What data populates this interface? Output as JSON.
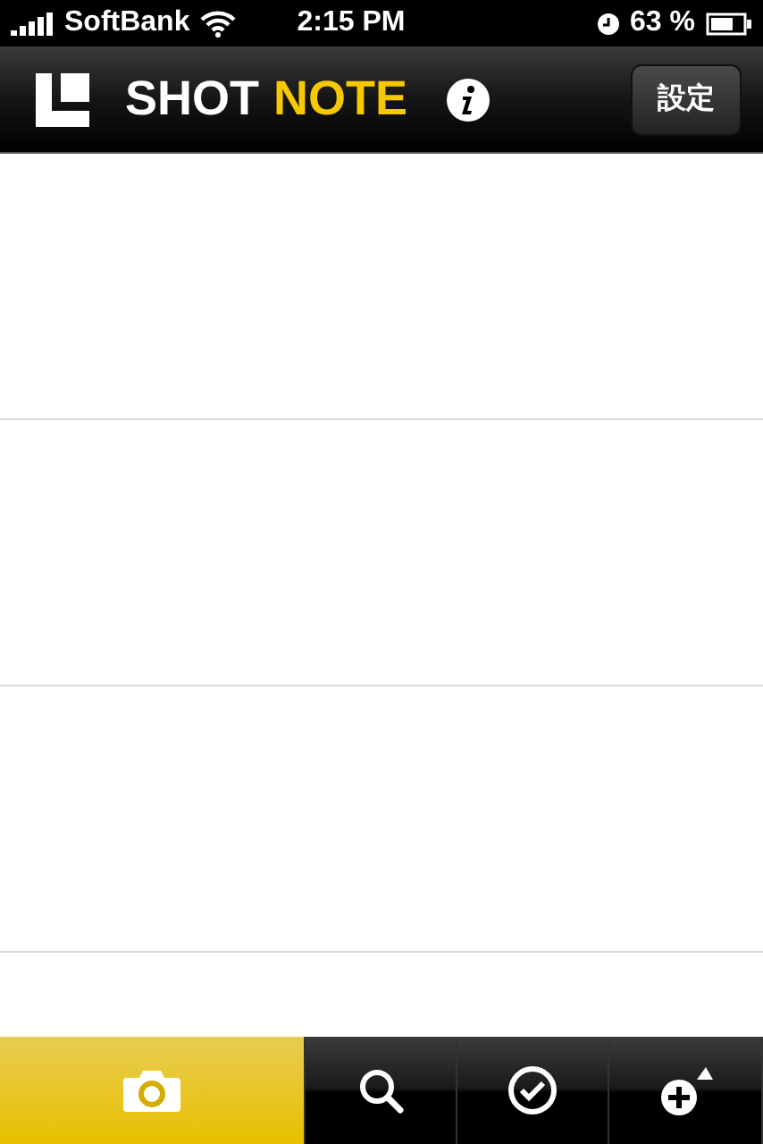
{
  "status_bar": {
    "carrier": "SoftBank",
    "time": "2:15 PM",
    "battery": "63 %"
  },
  "nav": {
    "title_first": "SHOT",
    "title_second": "NOTE",
    "settings_button": "設定"
  },
  "tabs": [
    {
      "kind": "camera",
      "selected": true
    },
    {
      "kind": "search",
      "selected": false
    },
    {
      "kind": "check",
      "selected": false
    },
    {
      "kind": "add",
      "selected": false
    }
  ]
}
